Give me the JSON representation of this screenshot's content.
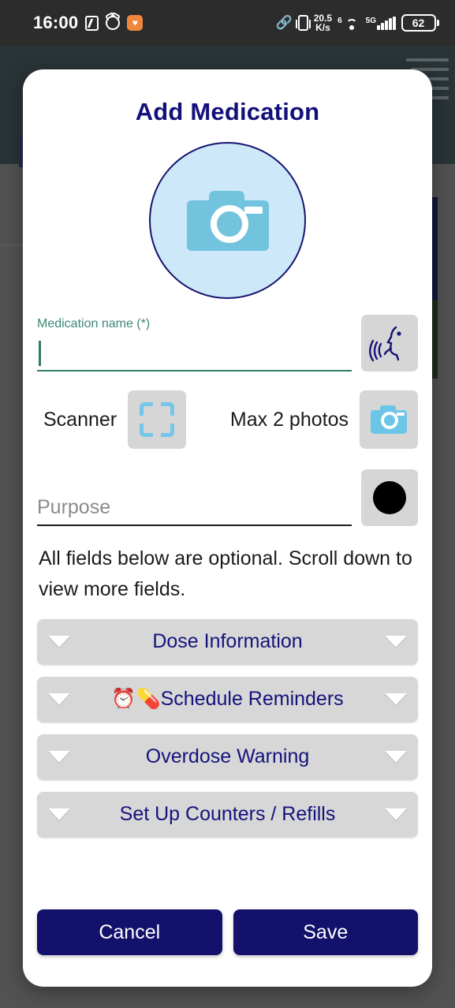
{
  "status_bar": {
    "time": "16:00",
    "left_icons": [
      "nfc-icon",
      "alarm-icon",
      "health-shield-badge-icon"
    ],
    "bluetooth_icon": "bluetooth-icon",
    "vibrate_icon": "vibrate-icon",
    "net_speed_value": "20.5",
    "net_speed_unit": "K/s",
    "wifi_superscript": "6",
    "wifi_icon": "wifi-icon",
    "network_type": "5G",
    "signal_icon": "signal-bars-icon",
    "battery_percent": "62"
  },
  "background_app": {
    "menu_icon": "hamburger-menu-icon"
  },
  "dialog": {
    "title": "Add Medication",
    "avatar_icon": "camera-placeholder-icon",
    "medication_name": {
      "label": "Medication name (*)",
      "value": "",
      "placeholder": "",
      "voice_button_icon": "voice-input-icon"
    },
    "scanner_row": {
      "scanner_label": "Scanner",
      "scanner_icon": "barcode-scan-frame-icon",
      "photos_label": "Max 2 photos",
      "photos_icon": "camera-icon"
    },
    "purpose": {
      "placeholder": "Purpose",
      "value": "",
      "record_button_icon": "record-dot-icon"
    },
    "info_text": "All fields below are optional. Scroll down to view more fields.",
    "sections": [
      {
        "label": "Dose Information",
        "emoji": "",
        "expanded": false
      },
      {
        "label": "Schedule Reminders",
        "emoji": "⏰💊",
        "expanded": false
      },
      {
        "label": "Overdose Warning",
        "emoji": "",
        "expanded": false
      },
      {
        "label": "Set Up Counters / Refills",
        "emoji": "",
        "expanded": false
      }
    ],
    "cancel_label": "Cancel",
    "save_label": "Save"
  },
  "colors": {
    "primary_navy": "#12116b",
    "title_navy": "#13107a",
    "label_teal": "#3f8776",
    "accent_blue": "#72c3de",
    "avatar_bg": "#cde8f8",
    "accordion_bg": "#d7d7d7",
    "status_bar_bg": "#2c2c2c",
    "appbar_bg": "#2b3d42",
    "scrim": "#6e6e6e"
  }
}
